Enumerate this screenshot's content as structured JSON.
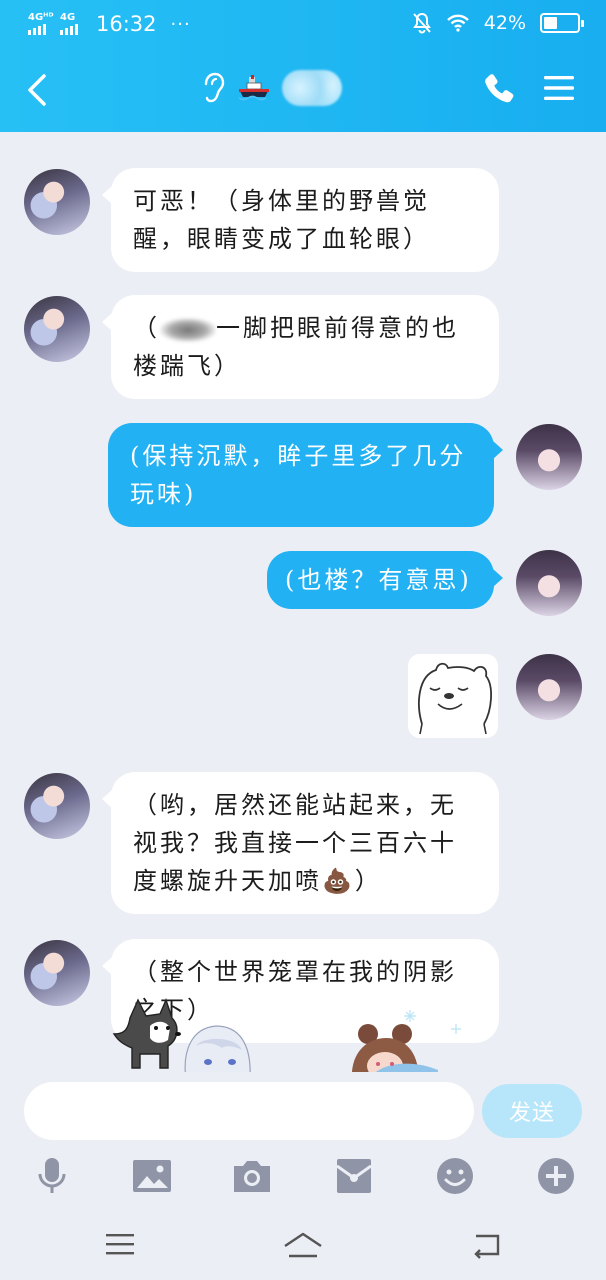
{
  "status_bar": {
    "network_1": "4Gᴴᴰ",
    "network_2": "4G",
    "time": "16:32",
    "more": "···",
    "battery_text": "42%",
    "battery_level": 0.42
  },
  "header": {
    "ship_emoji": "🚢"
  },
  "messages": [
    {
      "side": "in",
      "text": "可恶！（身体里的野兽觉醒，眼睛变成了血轮眼）"
    },
    {
      "side": "in",
      "text_after_blur": "一脚把眼前得意的也楼踹飞）",
      "text_before_blur": "（"
    },
    {
      "side": "out",
      "text": "(保持沉默，眸子里多了几分玩味)"
    },
    {
      "side": "out",
      "text": "(也楼？有意思)"
    },
    {
      "side": "out",
      "type": "sticker"
    },
    {
      "side": "in",
      "text": "（哟，居然还能站起来，无视我？我直接一个三百六十度螺旋升天加喷💩）"
    },
    {
      "side": "in",
      "text": "（整个世界笼罩在我的阴影之下）"
    }
  ],
  "input": {
    "placeholder": "",
    "value": "",
    "send_label": "发送"
  },
  "toolbar_icons": [
    "microphone-icon",
    "image-icon",
    "camera-icon",
    "red-packet-icon",
    "emoji-icon",
    "plus-icon"
  ],
  "system_nav": [
    "menu-icon",
    "home-icon",
    "back-icon"
  ]
}
